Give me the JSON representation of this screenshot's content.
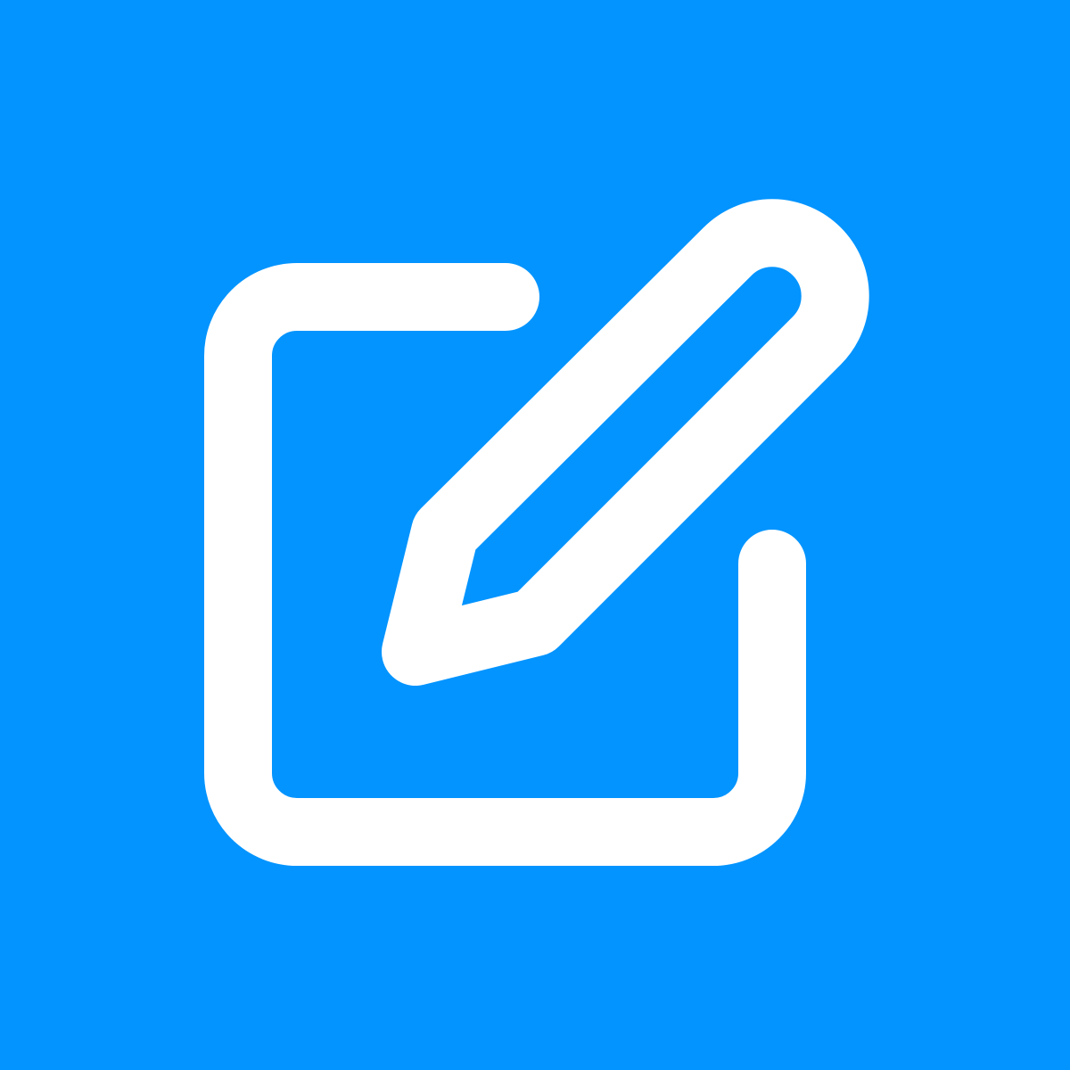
{
  "app_icon": {
    "icon_name": "edit-icon",
    "background_color": "#0394FF",
    "foreground_color": "#FFFFFF"
  }
}
